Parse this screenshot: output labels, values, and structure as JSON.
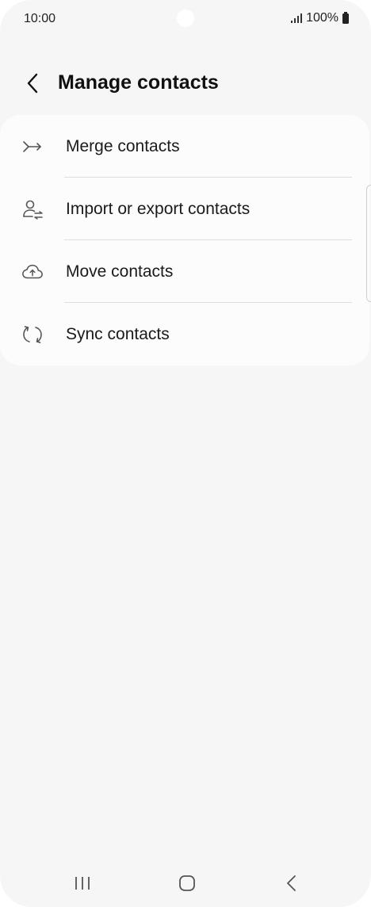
{
  "status_bar": {
    "time": "10:00",
    "battery_text": "100%"
  },
  "header": {
    "title": "Manage contacts",
    "back_icon": "chevron-left-icon"
  },
  "menu": {
    "items": [
      {
        "label": "Merge contacts",
        "icon": "merge-arrow-icon"
      },
      {
        "label": "Import or export contacts",
        "icon": "person-transfer-icon"
      },
      {
        "label": "Move contacts",
        "icon": "cloud-upload-icon"
      },
      {
        "label": "Sync contacts",
        "icon": "sync-icon"
      }
    ]
  },
  "nav_bar": {
    "icons": [
      "recent-apps-icon",
      "home-icon",
      "back-icon"
    ]
  },
  "colors": {
    "background": "#f6f6f6",
    "card": "#fcfcfc",
    "text": "#1a1a1a",
    "icon": "#555555"
  }
}
